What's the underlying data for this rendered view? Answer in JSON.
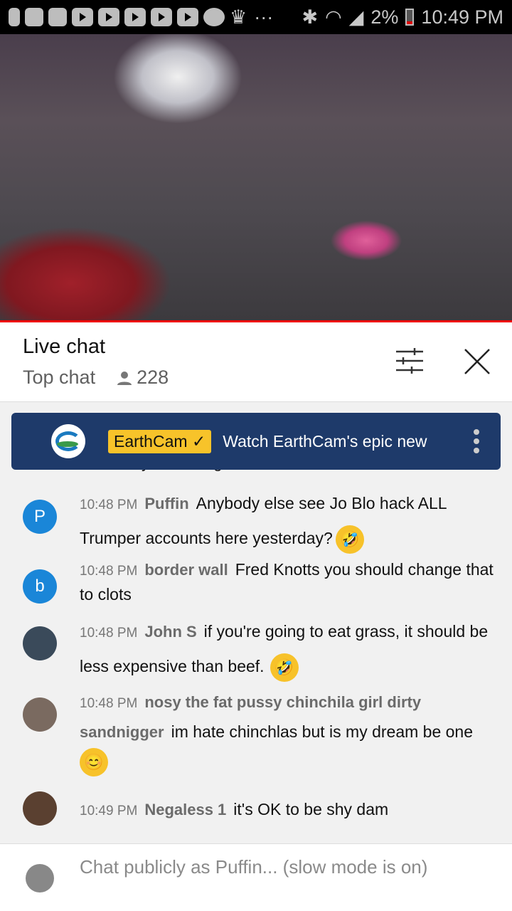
{
  "status_bar": {
    "battery": "2%",
    "time": "10:49 PM"
  },
  "header": {
    "title": "Live chat",
    "mode": "Top chat",
    "viewers": "228"
  },
  "pinned": {
    "channel": "EarthCam",
    "check": "✓",
    "text": "Watch EarthCam's epic new"
  },
  "partial_message": "what they are doing",
  "messages": [
    {
      "initial": "P",
      "color": "#1a86d8",
      "time": "10:48 PM",
      "author": "Puffin",
      "text": "Anybody else see Jo Blo hack ALL Trumper accounts here yesterday?",
      "emoji": "🤣"
    },
    {
      "initial": "b",
      "color": "#1a86d8",
      "time": "10:48 PM",
      "author": "border wall",
      "text": "Fred Knotts you should change that to clots",
      "emoji": ""
    },
    {
      "initial": "",
      "color": "#3a4a5a",
      "time": "10:48 PM",
      "author": "John S",
      "text": "if you're going to eat grass, it should be less expensive than beef.",
      "emoji": "🤣"
    },
    {
      "initial": "",
      "color": "#7a6a60",
      "time": "10:48 PM",
      "author": "nosy the fat pussy chinchila girl dirty sandnigger",
      "text": "im hate chinchlas but is my dream be one",
      "emoji": "😊"
    },
    {
      "initial": "",
      "color": "#5a4030",
      "time": "10:49 PM",
      "author": "Negaless 1",
      "text": "it's OK to be shy dam",
      "emoji": ""
    }
  ],
  "input": {
    "placeholder": "Chat publicly as Puffin... (slow mode is on)"
  }
}
